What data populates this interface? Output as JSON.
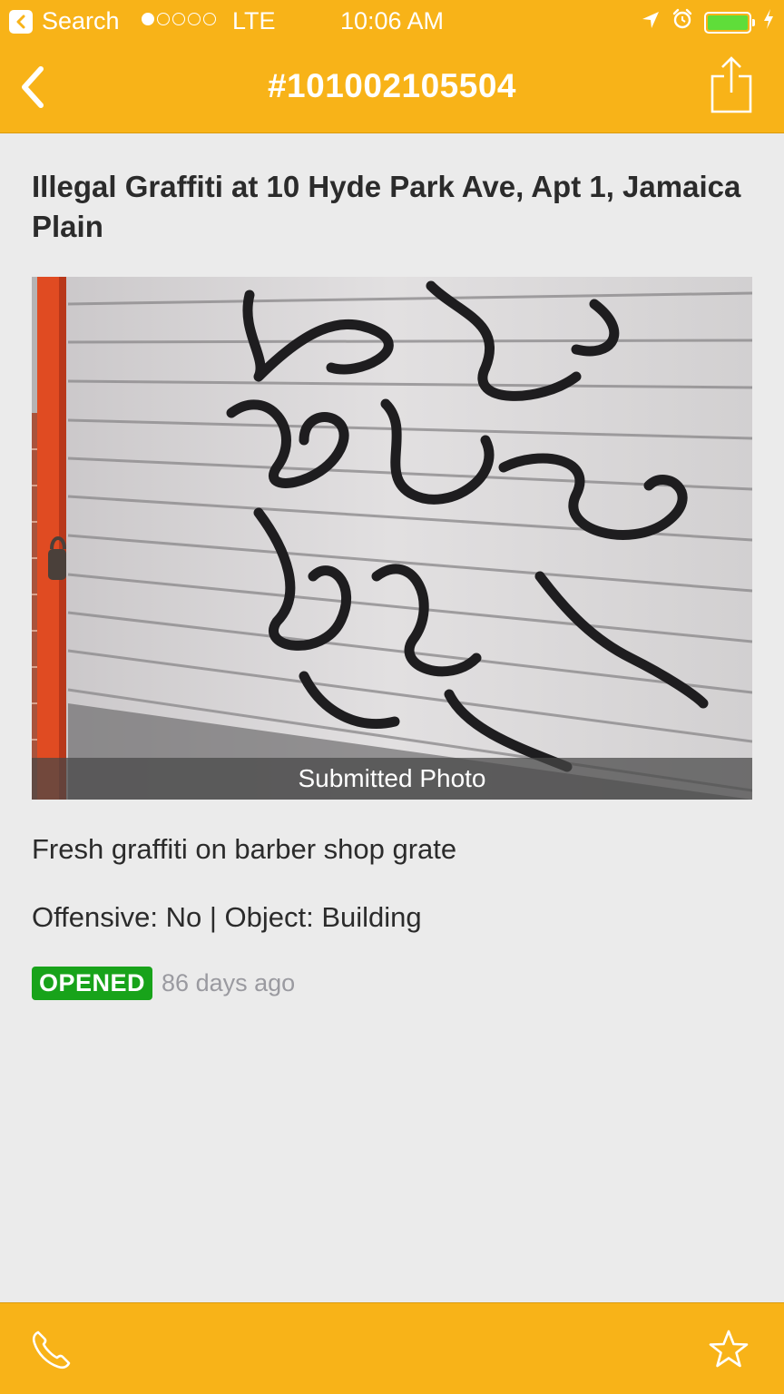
{
  "status_bar": {
    "back_app_label": "Search",
    "carrier": "LTE",
    "time": "10:06 AM",
    "signal_bars_filled": 1,
    "signal_bars_total": 5,
    "battery_level": 1.0,
    "battery_color": "#5fdd3a"
  },
  "nav": {
    "title": "#101002105504",
    "back_icon": "chevron-left-icon",
    "share_icon": "share-icon"
  },
  "report": {
    "title": "Illegal Graffiti at 10 Hyde Park Ave, Apt 1, Jamaica Plain",
    "photo_caption": "Submitted Photo",
    "description": "Fresh graffiti on barber shop grate",
    "attributes": "Offensive: No | Object: Building",
    "status": "OPENED",
    "status_color": "#18a31a",
    "age": "86 days ago"
  },
  "toolbar": {
    "call_icon": "phone-icon",
    "favorite_icon": "star-icon"
  },
  "theme": {
    "accent": "#f8b318",
    "background": "#ebebeb"
  }
}
